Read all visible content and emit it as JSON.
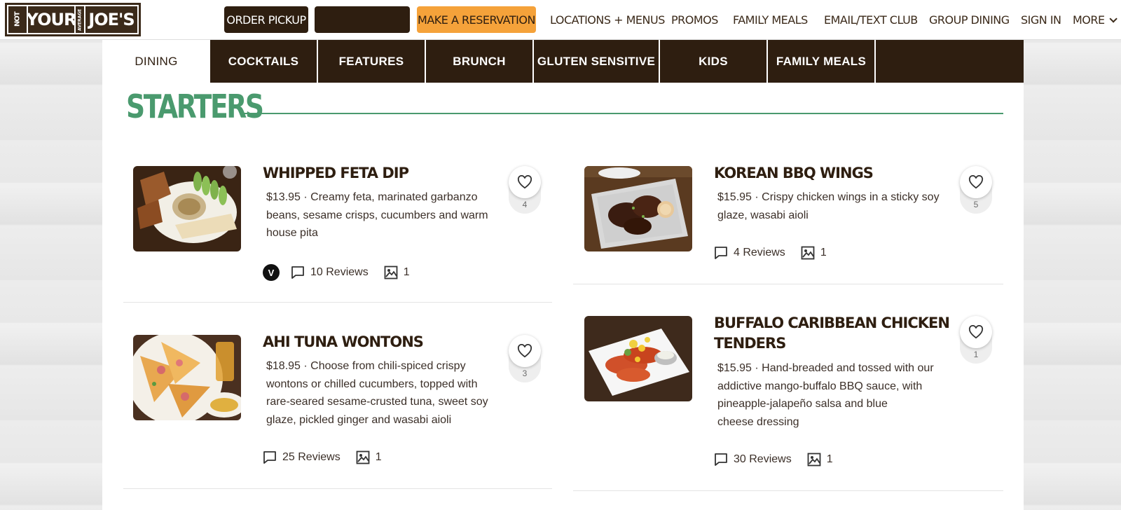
{
  "logo": {
    "not": "NOT",
    "your": "YOUR",
    "average": "AVERAGE",
    "joes": "JOE'S"
  },
  "header": {
    "order_pickup": "ORDER PICKUP",
    "reservation": "MAKE A RESERVATION",
    "nav": [
      "LOCATIONS + MENUS",
      "PROMOS",
      "FAMILY MEALS",
      "EMAIL/TEXT CLUB",
      "GROUP DINING",
      "SIGN IN"
    ],
    "more": "MORE"
  },
  "tabs": [
    "DINING",
    "COCKTAILS",
    "FEATURES",
    "BRUNCH",
    "GLUTEN SENSITIVE",
    "KIDS",
    "FAMILY MEALS"
  ],
  "section_title": "STARTERS",
  "items": [
    {
      "name": "WHIPPED FETA DIP",
      "desc_lines": [
        "$13.95 · Creamy feta, marinated garbanzo",
        "beans, sesame crisps, cucumbers and warm",
        "house pita"
      ],
      "favorites": "4",
      "badge": "V",
      "reviews": "10 Reviews",
      "photos": "1"
    },
    {
      "name": "KOREAN BBQ WINGS",
      "desc_lines": [
        "$15.95 · Crispy chicken wings in a sticky soy",
        "glaze, wasabi aioli"
      ],
      "favorites": "5",
      "reviews": "4 Reviews",
      "photos": "1"
    },
    {
      "name": "AHI TUNA WONTONS",
      "desc_lines": [
        "$18.95 · Choose from chili-spiced crispy",
        "wontons or chilled cucumbers, topped with",
        "rare-seared sesame-crusted tuna, sweet soy",
        "glaze, pickled ginger and wasabi aioli"
      ],
      "favorites": "3",
      "reviews": "25 Reviews",
      "photos": "1"
    },
    {
      "name_lines": [
        "BUFFALO CARIBBEAN CHICKEN",
        "TENDERS"
      ],
      "desc_lines": [
        "$15.95 · Hand-breaded and tossed with our",
        "addictive mango-buffalo BBQ sauce, with",
        "pineapple-jalapeño salsa and blue",
        "cheese dressing"
      ],
      "favorites": "1",
      "reviews": "30 Reviews",
      "photos": "1"
    }
  ],
  "colors": {
    "brand_brown": "#2e1e10",
    "accent_orange": "#f5a23a",
    "section_green": "#4a9a6e"
  }
}
